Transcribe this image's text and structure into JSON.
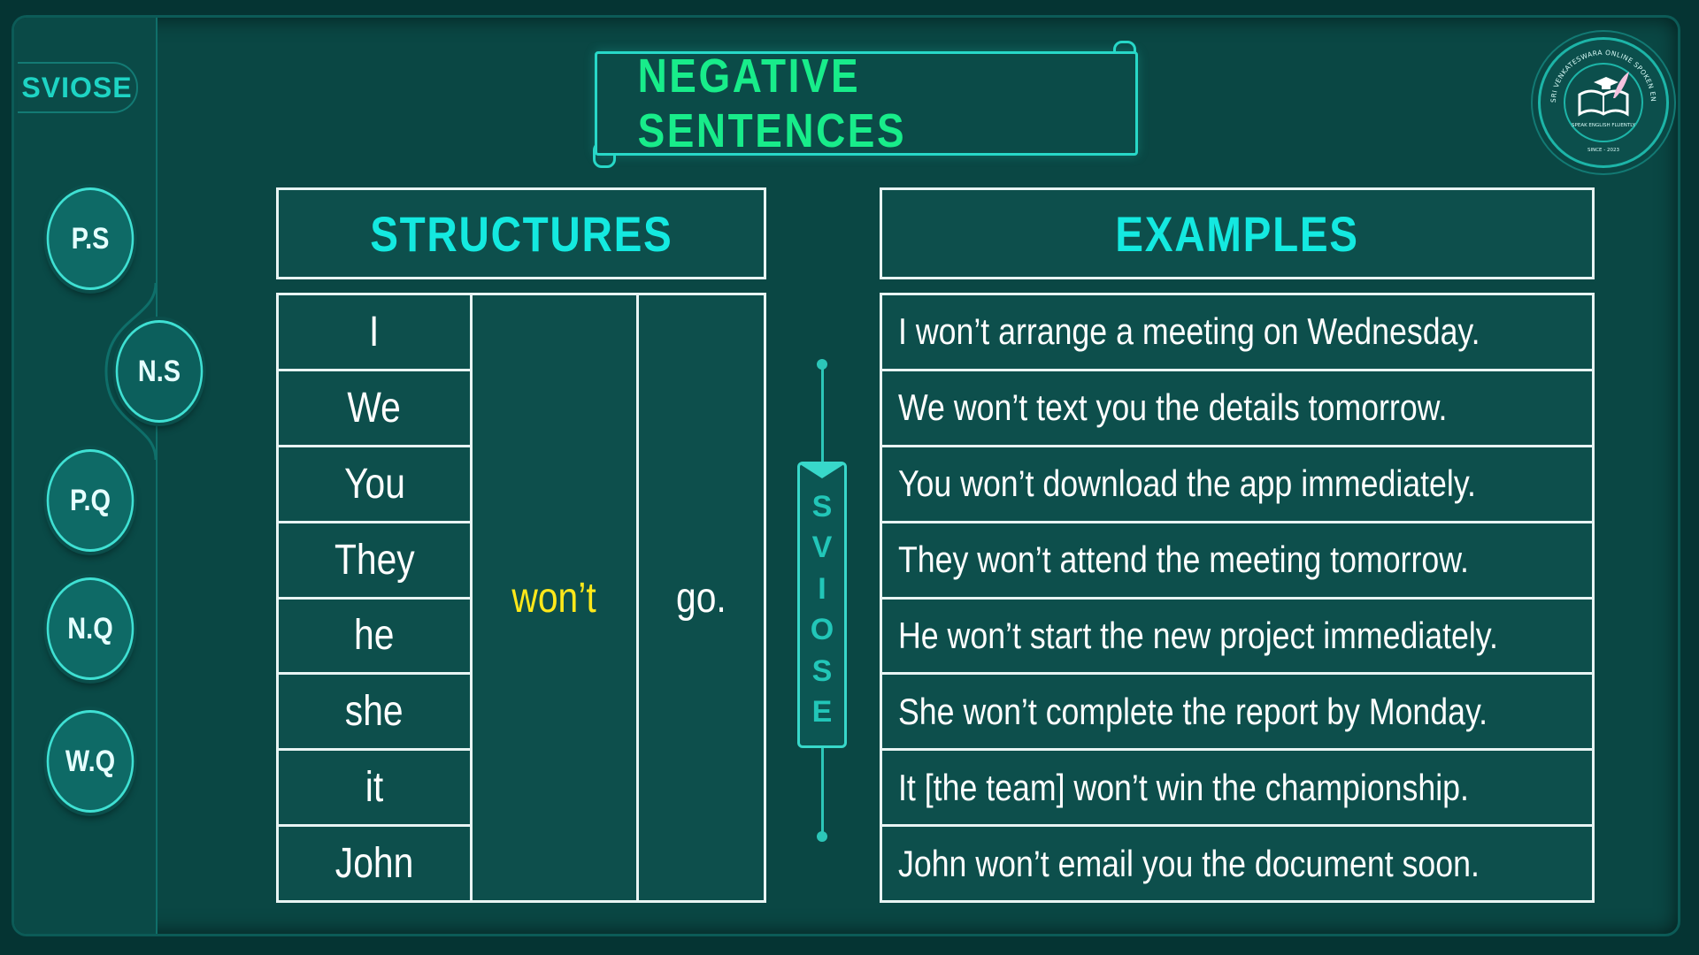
{
  "brand": {
    "text": "SVIOSE"
  },
  "title": "NEGATIVE SENTENCES",
  "nav": [
    {
      "label": "P.S",
      "active": false
    },
    {
      "label": "N.S",
      "active": true
    },
    {
      "label": "P.Q",
      "active": false
    },
    {
      "label": "N.Q",
      "active": false
    },
    {
      "label": "W.Q",
      "active": false
    }
  ],
  "structures": {
    "header": "STRUCTURES",
    "subjects": [
      "I",
      "We",
      "You",
      "They",
      "he",
      "she",
      "it",
      "John"
    ],
    "auxiliary": "won’t",
    "verb": "go."
  },
  "examples": {
    "header": "EXAMPLES",
    "rows": [
      "I won’t arrange a meeting on Wednesday.",
      "We won’t text you the details tomorrow.",
      "You won’t download the app immediately.",
      "They won’t attend the meeting tomorrow.",
      "He won’t start the new project immediately.",
      "She won’t complete the report by Monday.",
      "It [the team] won’t win the championship.",
      "John won’t email you the document soon."
    ]
  },
  "vertical_tag": [
    "S",
    "V",
    "I",
    "O",
    "S",
    "E"
  ],
  "logo": {
    "ring_text": "SRI VENKATESWARA ONLINE SPOKEN ENGLISH SCHOOL",
    "tagline": "SPEAK ENGLISH FLUENTLY",
    "since": "SINCE - 2023"
  },
  "colors": {
    "background": "#0a4744",
    "title": "#18ec8a",
    "header": "#14e9e0",
    "auxiliary": "#ffe81a",
    "accent": "#2cc6b8"
  }
}
